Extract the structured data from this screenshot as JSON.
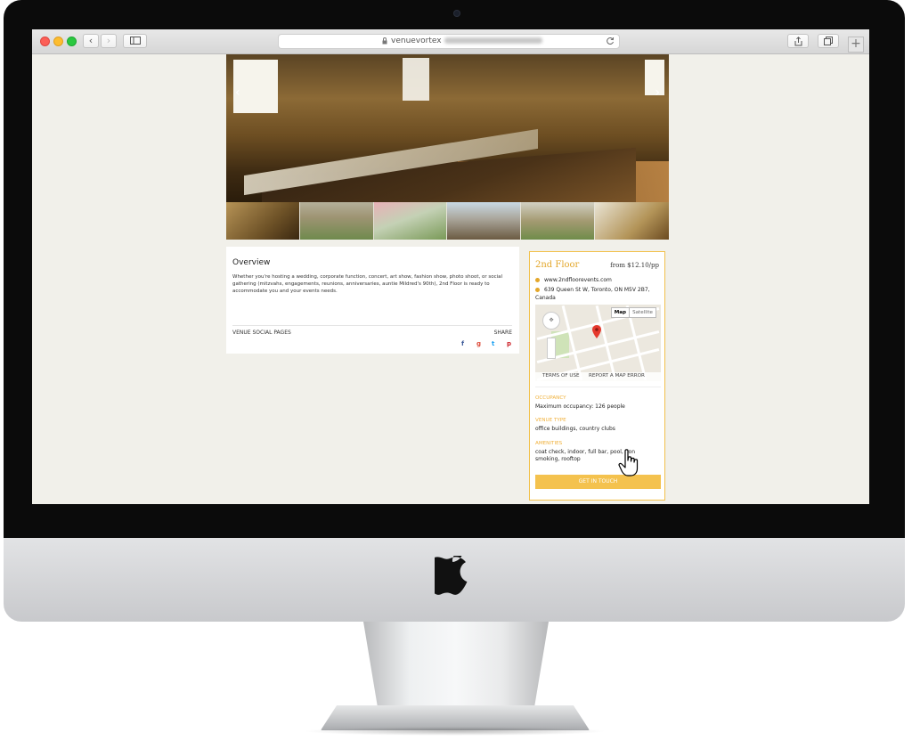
{
  "browser": {
    "url_text": "venuevortex",
    "buttons": {
      "back": "‹",
      "forward": "›",
      "new_tab": "+"
    }
  },
  "hero": {
    "prev_arrow": "‹",
    "next_arrow": "›"
  },
  "overview": {
    "title": "Overview",
    "body": "Whether you're hosting a wedding, corporate function, concert, art show, fashion show, photo shoot, or social gathering (mitzvahs, engagements, reunions, anniversaries, auntie Mildred's 90th), 2nd Floor is ready to accommodate you and your events needs.",
    "social_label": "VENUE SOCIAL PAGES",
    "share_label": "SHARE",
    "share_icons": {
      "facebook": "f",
      "google": "g",
      "twitter": "t",
      "pinterest": "p"
    }
  },
  "venue": {
    "name": "2nd Floor",
    "price": "from $12.10/pp",
    "website": "www.2ndfloorevents.com",
    "address": "639 Queen St W, Toronto, ON M5V 2B7, Canada",
    "map": {
      "toggle_map": "Map",
      "toggle_satellite": "Satellite",
      "terms": "TERMS OF USE",
      "report": "REPORT A MAP ERROR"
    },
    "occupancy_label": "OCCUPANCY",
    "occupancy_value": "Maximum occupancy: 126 people",
    "type_label": "VENUE TYPE",
    "type_value": "office buildings, country clubs",
    "amenities_label": "AMENITIES",
    "amenities_value": "coat check, indoor, full bar, pool, non smoking, rooftop",
    "cta_label": "GET IN TOUCH"
  },
  "colors": {
    "accent": "#f4c24e",
    "accent_text": "#e3a72b",
    "page_bg": "#f1f0ea",
    "facebook": "#3b5998",
    "google": "#dd4b39",
    "twitter": "#1da1f2",
    "pinterest": "#cb2027"
  }
}
